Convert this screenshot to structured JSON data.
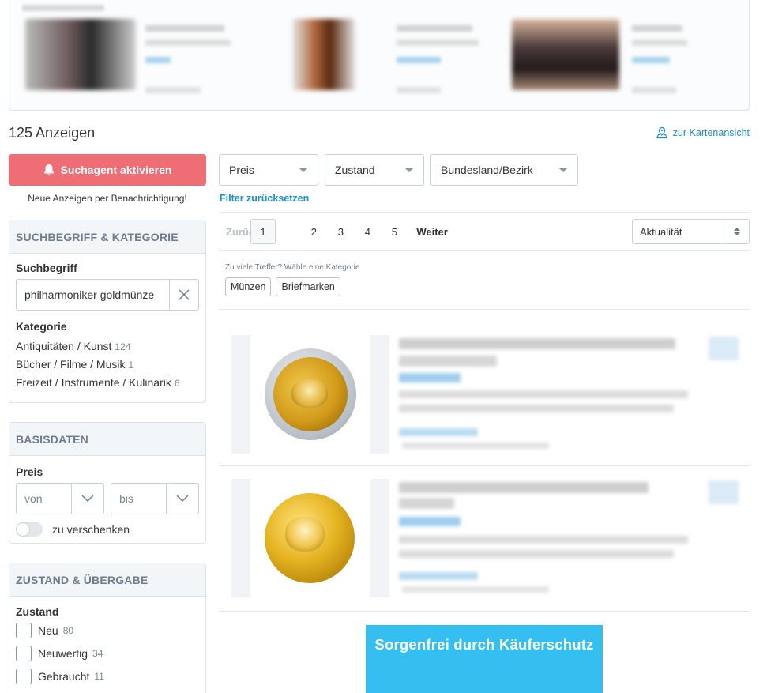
{
  "results": {
    "count_label": "125 Anzeigen",
    "map_link": "zur Kartenansicht"
  },
  "sidebar": {
    "agent_button": "Suchagent aktivieren",
    "agent_note": "Neue Anzeigen per Benachrichtigung!",
    "search_panel": {
      "title": "SUCHBEGRIFF & KATEGORIE",
      "search_label": "Suchbegriff",
      "search_value": "philharmoniker goldmünze",
      "category_label": "Kategorie",
      "categories": [
        {
          "name": "Antiquitäten / Kunst",
          "count": "124"
        },
        {
          "name": "Bücher / Filme / Musik",
          "count": "1"
        },
        {
          "name": "Freizeit / Instrumente / Kulinarik",
          "count": "6"
        }
      ]
    },
    "basis_panel": {
      "title": "BASISDATEN",
      "price_label": "Preis",
      "from_placeholder": "von",
      "to_placeholder": "bis",
      "giveaway_label": "zu verschenken",
      "giveaway_on": false
    },
    "condition_panel": {
      "title": "ZUSTAND & ÜBERGABE",
      "condition_label": "Zustand",
      "options": [
        {
          "name": "Neu",
          "count": "80"
        },
        {
          "name": "Neuwertig",
          "count": "34"
        },
        {
          "name": "Gebraucht",
          "count": "11"
        }
      ]
    }
  },
  "filters": {
    "price": "Preis",
    "condition": "Zustand",
    "region": "Bundesland/Bezirk",
    "reset": "Filter zurücksetzen"
  },
  "pagination": {
    "back": "Zurück",
    "pages": [
      "1",
      "2",
      "3",
      "4",
      "5"
    ],
    "active_page": "1",
    "next": "Weiter"
  },
  "sort": {
    "value": "Aktualität"
  },
  "category_hint": {
    "text": "Zu viele Treffer? Wähle eine Kategorie",
    "tags": [
      "Münzen",
      "Briefmarken"
    ]
  },
  "banner": {
    "text": "Sorgenfrei durch Käuferschutz"
  },
  "colors": {
    "accent_blue": "#1a8fd1",
    "agent_red": "#ef6e76",
    "banner_blue": "#35bef0",
    "panel_head_text": "#6d7d8e"
  },
  "icons": {
    "map": "map-pin-icon",
    "bell": "bell-icon",
    "clear": "close-icon",
    "chevron": "chevron-down-icon"
  }
}
